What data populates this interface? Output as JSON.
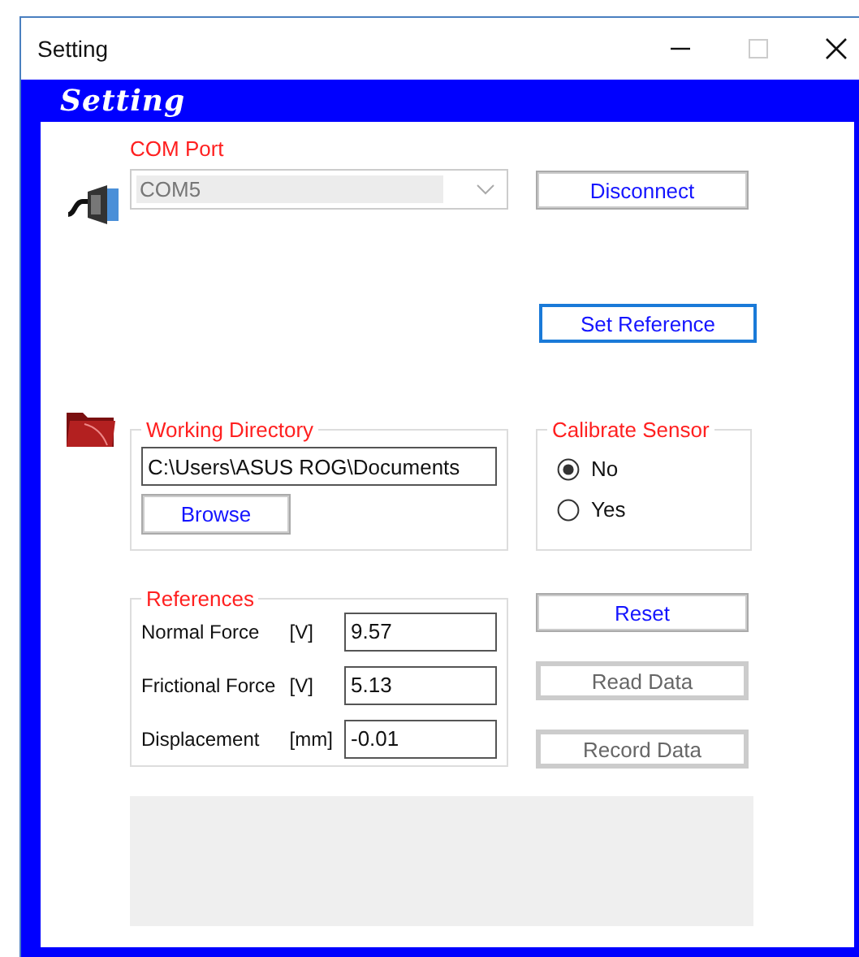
{
  "window": {
    "title": "Setting"
  },
  "header": {
    "title": "Setting"
  },
  "com_port": {
    "label": "COM Port",
    "value": "COM5",
    "disabled": true
  },
  "disconnect_button": {
    "label": "Disconnect",
    "disabled": false,
    "focused": false
  },
  "set_reference_button": {
    "label": "Set Reference",
    "disabled": false,
    "focused": true
  },
  "working_directory": {
    "title": "Working Directory",
    "value": "C:\\Users\\ASUS ROG\\Documents",
    "browse_button": {
      "label": "Browse",
      "disabled": false,
      "focused": false
    }
  },
  "calibrate_sensor": {
    "title": "Calibrate Sensor",
    "options": [
      {
        "label": "No",
        "selected": true
      },
      {
        "label": "Yes",
        "selected": false
      }
    ]
  },
  "references": {
    "title": "References",
    "rows": [
      {
        "label": "Normal Force",
        "unit": "[V]",
        "value": "9.57"
      },
      {
        "label": "Frictional Force",
        "unit": "[V]",
        "value": "5.13"
      },
      {
        "label": "Displacement",
        "unit": "[mm]",
        "value": "-0.01"
      }
    ]
  },
  "side_buttons": [
    {
      "label": "Reset",
      "disabled": false,
      "focused": false
    },
    {
      "label": "Read Data",
      "disabled": true,
      "focused": false
    },
    {
      "label": "Record Data",
      "disabled": true,
      "focused": false
    }
  ]
}
